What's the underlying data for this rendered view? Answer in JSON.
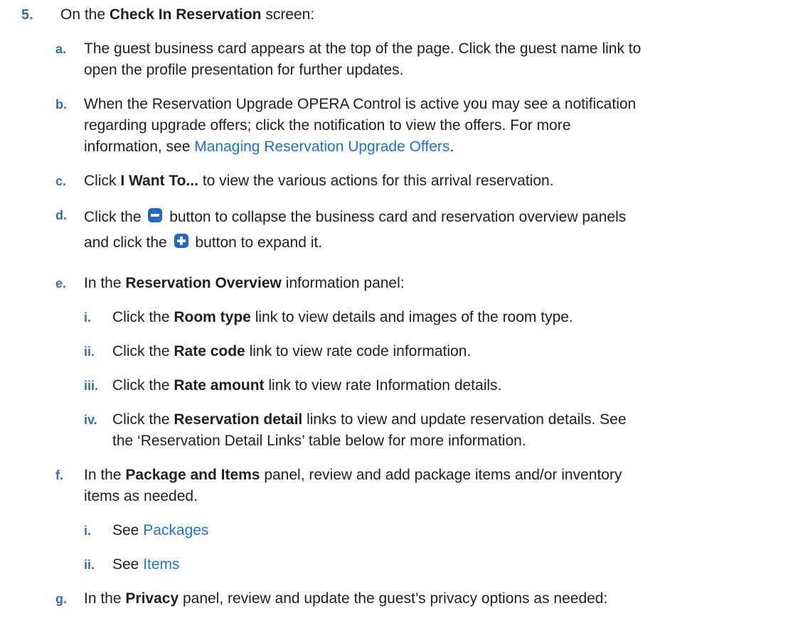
{
  "step5": {
    "num": "5.",
    "pre": "On the ",
    "bold": "Check In Reservation",
    "post": " screen:"
  },
  "a": {
    "letter": "a.",
    "line1": "The guest business card appears at the top of the page. Click the guest name link to",
    "line2": "open the profile presentation for further updates."
  },
  "b": {
    "letter": "b.",
    "line1": "When the Reservation Upgrade OPERA Control is active you may see a notification",
    "line2": "regarding upgrade offers; click the notification to view the offers. For more",
    "line3_pre": "information, see ",
    "line3_link": "Managing Reservation Upgrade Offers",
    "line3_post": "."
  },
  "c": {
    "letter": "c.",
    "pre": "Click ",
    "bold": "I Want To...",
    "post": " to view the various actions for this arrival reservation."
  },
  "d": {
    "letter": "d.",
    "line1_pre": "Click the ",
    "line1_post": " button to collapse the business card and reservation overview panels",
    "line2_pre": "and click the ",
    "line2_post": " button to expand it.",
    "icon1": "minus-icon",
    "icon2": "plus-icon"
  },
  "e": {
    "letter": "e.",
    "pre": "In the ",
    "bold": "Reservation Overview",
    "post": " information panel:",
    "items": [
      {
        "num": "i.",
        "pre": "Click the ",
        "bold": "Room type",
        "post": " link to view details and images of the room type."
      },
      {
        "num": "ii.",
        "pre": "Click the ",
        "bold": "Rate code",
        "post": " link to view rate code information."
      },
      {
        "num": "iii.",
        "pre": "Click the ",
        "bold": "Rate amount",
        "post": " link to view rate Information details."
      },
      {
        "num": "iv.",
        "pre": "Click the ",
        "bold": "Reservation detail",
        "post": " links to view and update reservation details. See",
        "line2": "the ‘Reservation Detail Links’ table below for more information."
      }
    ]
  },
  "f": {
    "letter": "f.",
    "pre": "In the ",
    "bold": "Package and Items",
    "post": " panel, review and add package items and/or inventory",
    "line2": "items as needed.",
    "items": [
      {
        "num": "i.",
        "pre": "See ",
        "link": "Packages"
      },
      {
        "num": "ii.",
        "pre": "See ",
        "link": "Items"
      }
    ]
  },
  "g": {
    "letter": "g.",
    "pre": "In the ",
    "bold": "Privacy",
    "post": " panel, review and update the guest’s privacy options as needed:"
  },
  "colors": {
    "accent": "#2f6fb5",
    "link": "#1a73d9",
    "icon": "#2368c4"
  }
}
